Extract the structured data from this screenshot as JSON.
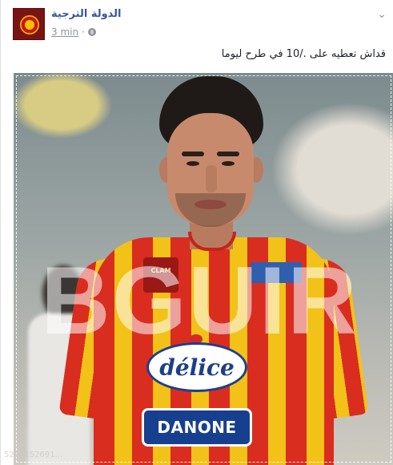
{
  "post": {
    "page_name": "الدولة الترجية",
    "timestamp": "3 min",
    "separator": "·",
    "text": "قداش تعطيه على ./10 في طرح ليوما"
  },
  "photo": {
    "overlay_text": "BGUIR",
    "sponsor_top": "délice",
    "sponsor_bottom": "DANONE",
    "badge_text": "CLAM",
    "watermark": "5263152691..."
  },
  "icons": {
    "avatar": "team-crest-icon",
    "privacy": "globe-icon",
    "menu": "chevron-down-icon"
  },
  "colors": {
    "link": "#365899",
    "meta": "#90949c",
    "jersey_red": "#d92d1f",
    "jersey_yellow": "#f2c218"
  }
}
